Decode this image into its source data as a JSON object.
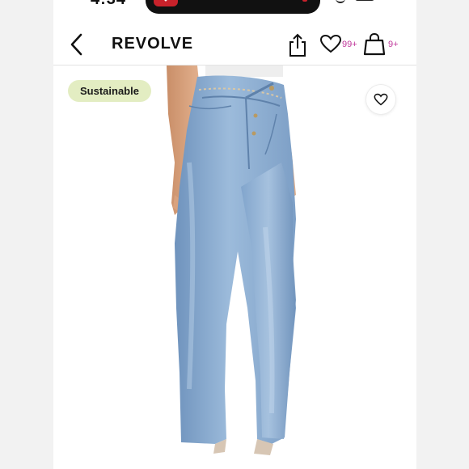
{
  "status_bar": {
    "time": "4:34"
  },
  "header": {
    "brand": "REVOLVE",
    "wishlist_count": "99+",
    "bag_count": "9+"
  },
  "product": {
    "badge": "Sustainable"
  },
  "colors": {
    "accent_count": "#c0399b",
    "badge_bg": "#e3edc2",
    "denim": "#8aaccf"
  },
  "icons": [
    "back-chevron-icon",
    "share-icon",
    "heart-icon",
    "shopping-bag-icon",
    "heart-outline-icon"
  ]
}
